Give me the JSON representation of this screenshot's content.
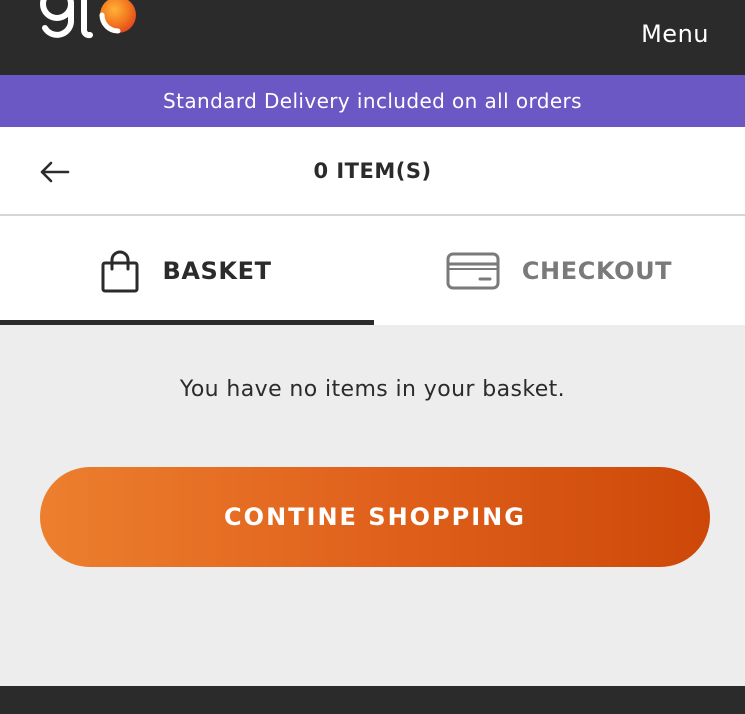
{
  "header": {
    "logo_text": "glo",
    "menu_label": "Menu"
  },
  "promo": {
    "text": "Standard Delivery included on all orders"
  },
  "cart": {
    "item_count_label": "0 ITEM(S)"
  },
  "tabs": [
    {
      "label": "BASKET",
      "icon": "shopping-bag-icon",
      "active": true
    },
    {
      "label": "CHECKOUT",
      "icon": "credit-card-icon",
      "active": false
    }
  ],
  "basket": {
    "empty_message": "You have no items in your basket.",
    "continue_label": "CONTINE SHOPPING"
  },
  "colors": {
    "header_bg": "#2b2b2b",
    "promo_bg": "#6b58c4",
    "accent_start": "#ec7f2e",
    "accent_end": "#cd4808",
    "content_bg": "#ededed"
  }
}
